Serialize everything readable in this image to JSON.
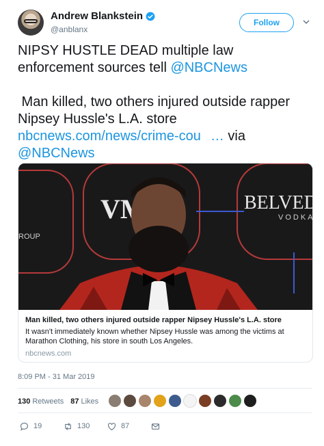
{
  "author": {
    "name": "Andrew Blankstein",
    "handle": "@anblanx",
    "verified": true
  },
  "follow_label": "Follow",
  "tweet": {
    "line1": "NIPSY HUSTLE DEAD multiple law",
    "line2_text": "enforcement sources tell ",
    "line2_mention": "@NBCNews",
    "line3": " Man killed, two others injured outside rapper",
    "line4": "Nipsey Hussle's L.A. store",
    "link_text": "nbcnews.com/news/crime-cou",
    "ellipsis": "…",
    "via": " via",
    "mention2": "@NBCNews"
  },
  "card": {
    "image_signs": {
      "vm": "VM",
      "belved": "BELVED",
      "vodka": "VODKA",
      "roup": "ROUP"
    },
    "title": "Man killed, two others injured outside rapper Nipsey Hussle's L.A. store",
    "description": "It wasn't immediately known whether Nipsey Hussle was among the victims at Marathon Clothing, his store in south Los Angeles.",
    "domain": "nbcnews.com"
  },
  "timestamp": "8:09 PM - 31 Mar 2019",
  "stats": {
    "retweets_count": "130",
    "retweets_label": "Retweets",
    "likes_count": "87",
    "likes_label": "Likes"
  },
  "actions": {
    "replies": "19",
    "retweets": "130",
    "likes": "87"
  },
  "colors": {
    "accent": "#1da1f2",
    "link": "#1b95e0",
    "muted": "#657786"
  },
  "icons": [
    "verified-badge-icon",
    "chevron-down-icon",
    "reply-icon",
    "retweet-icon",
    "heart-icon",
    "message-icon"
  ]
}
